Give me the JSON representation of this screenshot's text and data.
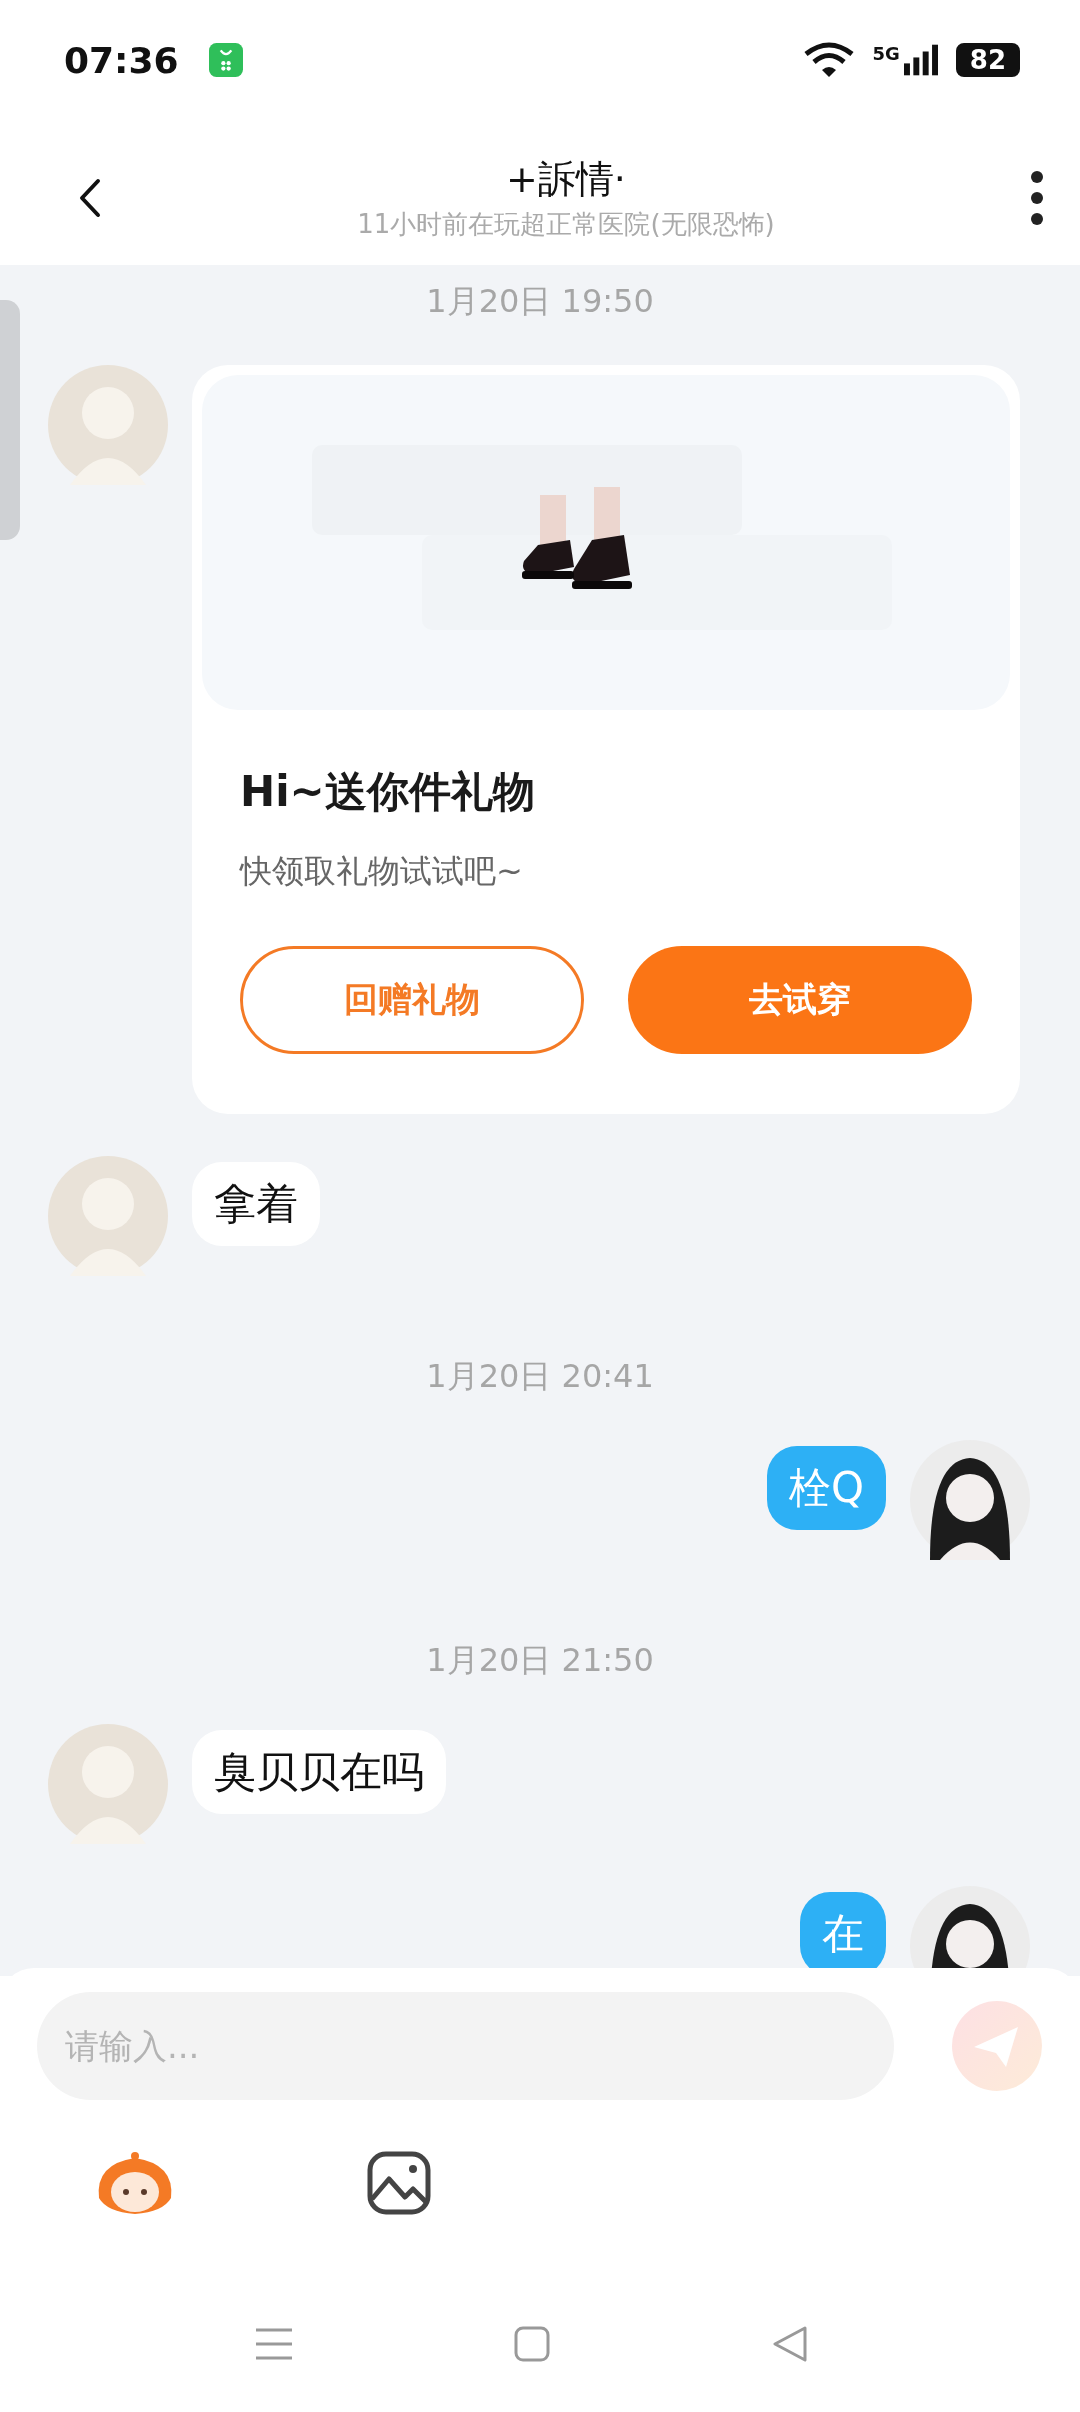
{
  "status_bar": {
    "time": "07:36",
    "network": "5G",
    "battery": "82"
  },
  "header": {
    "title": "+訴情·",
    "subtitle": "11小时前在玩超正常医院(无限恐怖)"
  },
  "messages": [
    {
      "kind": "time",
      "text": "1月20日 19:50"
    },
    {
      "kind": "gift",
      "outgoing": false,
      "title": "Hi~送你件礼物",
      "text": "快领取礼物试试吧~",
      "buttons": [
        {
          "label": "回赠礼物",
          "kind": "outline"
        },
        {
          "label": "去试穿",
          "kind": "filled"
        }
      ]
    },
    {
      "kind": "text",
      "outgoing": false,
      "text": "拿着"
    },
    {
      "kind": "time",
      "text": "1月20日 20:41"
    },
    {
      "kind": "text",
      "outgoing": true,
      "text": "栓Q"
    },
    {
      "kind": "time",
      "text": "1月20日 21:50"
    },
    {
      "kind": "text",
      "outgoing": false,
      "text": "臭贝贝在吗"
    },
    {
      "kind": "text",
      "outgoing": true,
      "text": "在"
    }
  ],
  "composer": {
    "placeholder": "请输入..."
  }
}
